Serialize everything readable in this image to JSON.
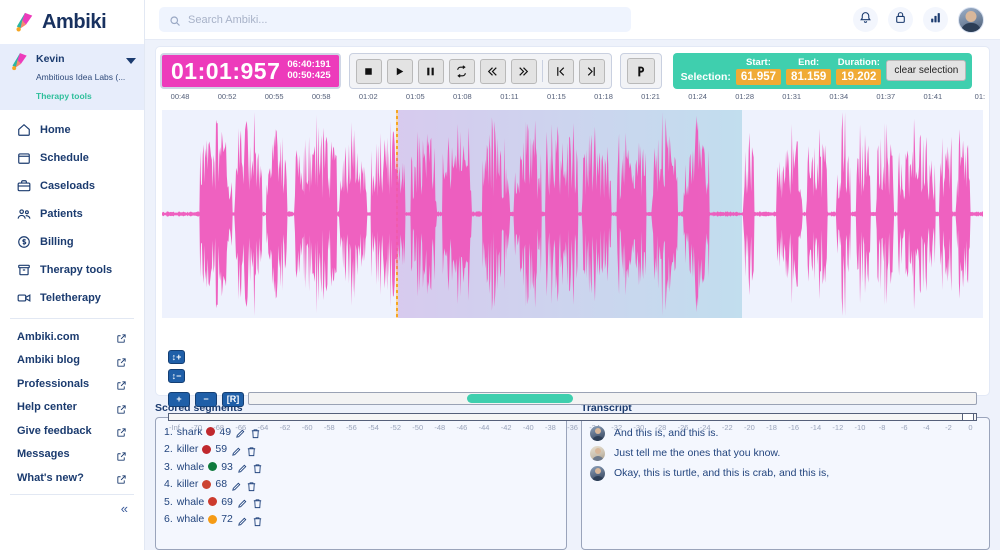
{
  "brand": {
    "name": "Ambiki",
    "logo_icon": "ambiki-logo-icon"
  },
  "profile": {
    "name": "Kevin",
    "org": "Ambitious Idea Labs (...",
    "context": "Therapy tools",
    "caret_icon": "chevron-down-icon"
  },
  "sidebar": {
    "nav": [
      {
        "label": "Home",
        "icon": "home-icon"
      },
      {
        "label": "Schedule",
        "icon": "calendar-icon"
      },
      {
        "label": "Caseloads",
        "icon": "briefcase-icon"
      },
      {
        "label": "Patients",
        "icon": "users-icon"
      },
      {
        "label": "Billing",
        "icon": "dollar-circle-icon"
      },
      {
        "label": "Therapy tools",
        "icon": "archive-icon"
      },
      {
        "label": "Teletherapy",
        "icon": "video-camera-icon"
      }
    ],
    "links": [
      {
        "label": "Ambiki.com",
        "icon": "external-link-icon"
      },
      {
        "label": "Ambiki blog",
        "icon": "external-link-icon"
      },
      {
        "label": "Professionals",
        "icon": "external-link-icon"
      },
      {
        "label": "Help center",
        "icon": "external-link-icon"
      },
      {
        "label": "Give feedback",
        "icon": "external-link-icon"
      },
      {
        "label": "Messages",
        "icon": "external-link-icon"
      },
      {
        "label": "What's new?",
        "icon": "external-link-icon"
      }
    ],
    "collapse_glyph": "«"
  },
  "topbar": {
    "search_placeholder": "Search Ambiki...",
    "search_value": "",
    "search_icon": "search-icon",
    "icons": [
      {
        "name": "notifications-icon"
      },
      {
        "name": "lock-icon"
      },
      {
        "name": "analytics-bar-chart-icon"
      }
    ],
    "avatar": "user-avatar"
  },
  "player": {
    "timer_main": "01:01:957",
    "timer_total": "06:40:191",
    "timer_secondary": "00:50:425",
    "transport": [
      {
        "name": "stop-button",
        "glyph": "stop"
      },
      {
        "name": "play-button",
        "glyph": "play"
      },
      {
        "name": "pause-button",
        "glyph": "pause"
      },
      {
        "name": "loop-button",
        "glyph": "loop"
      },
      {
        "name": "rewind-button",
        "glyph": "rewind"
      },
      {
        "name": "fast-forward-button",
        "glyph": "forward"
      },
      {
        "name": "skip-to-start-button",
        "glyph": "skip-start"
      },
      {
        "name": "skip-to-end-button",
        "glyph": "skip-end"
      }
    ],
    "marker_button": {
      "name": "marker-button",
      "label": "P"
    },
    "selection": {
      "label": "Selection:",
      "start_label": "Start:",
      "start_value": "61.957",
      "end_label": "End:",
      "end_value": "81.159",
      "duration_label": "Duration:",
      "duration_value": "19.202",
      "clear_label": "clear selection"
    },
    "zoom": {
      "vertical_in": "↕+",
      "vertical_out": "↕−",
      "horizontal_in": "+",
      "horizontal_out": "−",
      "reset": "[R]"
    }
  },
  "ruler": {
    "labels": [
      "00:48",
      "00:52",
      "00:55",
      "00:58",
      "01:02",
      "01:05",
      "01:08",
      "01:11",
      "01:15",
      "01:18",
      "01:21",
      "01:24",
      "01:28",
      "01:31",
      "01:34",
      "01:37",
      "01:41",
      "01:"
    ]
  },
  "db_scale": {
    "labels": [
      "-Inf",
      "-70",
      "-68",
      "-66",
      "-64",
      "-62",
      "-60",
      "-58",
      "-56",
      "-54",
      "-52",
      "-50",
      "-48",
      "-46",
      "-44",
      "-42",
      "-40",
      "-38",
      "-36",
      "-34",
      "-32",
      "-30",
      "-28",
      "-26",
      "-24",
      "-22",
      "-20",
      "-18",
      "-16",
      "-14",
      "-12",
      "-10",
      "-8",
      "-6",
      "-4",
      "-2",
      "0"
    ]
  },
  "colors": {
    "accent_pink": "#ed3bbb",
    "teal": "#3fcfae",
    "amber": "#f0ab35",
    "navy": "#1b3b6f",
    "waveform": "#ef55bb"
  },
  "scored_segments": {
    "title": "Scored segments",
    "items": [
      {
        "index": "1.",
        "word": "shark",
        "color": "#c0282d",
        "score": "49",
        "edit_icon": "pencil-icon",
        "delete_icon": "trash-icon"
      },
      {
        "index": "2.",
        "word": "killer",
        "color": "#c0282d",
        "score": "59",
        "edit_icon": "pencil-icon",
        "delete_icon": "trash-icon"
      },
      {
        "index": "3.",
        "word": "whale",
        "color": "#0f7a3d",
        "score": "93",
        "edit_icon": "pencil-icon",
        "delete_icon": "trash-icon"
      },
      {
        "index": "4.",
        "word": "killer",
        "color": "#cc4432",
        "score": "68",
        "edit_icon": "pencil-icon",
        "delete_icon": "trash-icon"
      },
      {
        "index": "5.",
        "word": "whale",
        "color": "#cc3b2e",
        "score": "69",
        "edit_icon": "pencil-icon",
        "delete_icon": "trash-icon"
      },
      {
        "index": "6.",
        "word": "whale",
        "color": "#f59b16",
        "score": "72",
        "edit_icon": "pencil-icon",
        "delete_icon": "trash-icon"
      }
    ]
  },
  "transcript": {
    "title": "Transcript",
    "lines": [
      {
        "speaker": "a",
        "text": "And this is, and this is."
      },
      {
        "speaker": "b",
        "text": "Just tell me the ones that you know."
      },
      {
        "speaker": "a",
        "text": "Okay, this is turtle, and this is crab, and this is,"
      }
    ]
  }
}
